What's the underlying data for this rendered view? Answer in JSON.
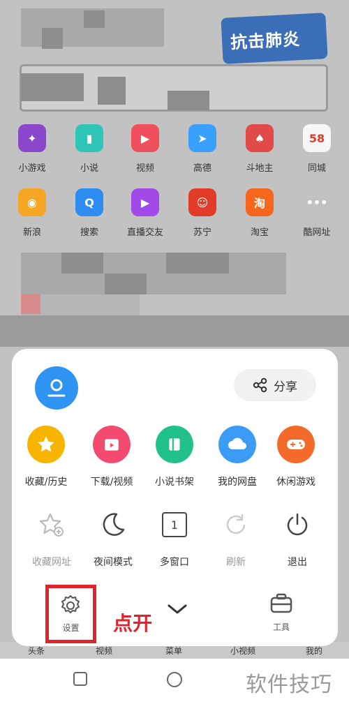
{
  "banner": {
    "text": "抗击肺炎"
  },
  "apps": [
    {
      "label": "小游戏",
      "color": "#8a47c9",
      "glyph": "✦"
    },
    {
      "label": "小说",
      "color": "#2ec4b6",
      "glyph": "▮"
    },
    {
      "label": "视频",
      "color": "#f0505e",
      "glyph": "▶"
    },
    {
      "label": "高德",
      "color": "#3aa0ff",
      "glyph": "➤"
    },
    {
      "label": "斗地主",
      "color": "#e24a4a",
      "glyph": "♠"
    },
    {
      "label": "同城",
      "color": "#f7f7f7",
      "glyph": "58"
    },
    {
      "label": "新浪",
      "color": "#f5a623",
      "glyph": "◉"
    },
    {
      "label": "搜索",
      "color": "#2d8cf0",
      "glyph": "Q"
    },
    {
      "label": "直播交友",
      "color": "#a149e8",
      "glyph": "▶"
    },
    {
      "label": "苏宁",
      "color": "#e23b2a",
      "glyph": "☺"
    },
    {
      "label": "淘宝",
      "color": "#f6661c",
      "glyph": "淘"
    },
    {
      "label": "酷网址",
      "color": "#c2c2c2",
      "glyph": "•••"
    }
  ],
  "bottom_tabs": [
    "头条",
    "视频",
    "菜单",
    "小视频",
    "我的"
  ],
  "menu": {
    "share_label": "分享",
    "row1": [
      {
        "label": "收藏/历史",
        "color": "#f7b500",
        "icon": "star-icon"
      },
      {
        "label": "下载/视频",
        "color": "#f34b6f",
        "icon": "download-folder-icon"
      },
      {
        "label": "小说书架",
        "color": "#21c18b",
        "icon": "book-icon"
      },
      {
        "label": "我的网盘",
        "color": "#3c9cf5",
        "icon": "cloud-icon"
      },
      {
        "label": "休闲游戏",
        "color": "#f36b2a",
        "icon": "gamepad-icon"
      }
    ],
    "row2": [
      {
        "label": "收藏网址",
        "disabled": true,
        "icon": "add-favorite-icon"
      },
      {
        "label": "夜间模式",
        "disabled": false,
        "icon": "moon-icon"
      },
      {
        "label": "多窗口",
        "disabled": false,
        "icon": "window-count-icon",
        "count": "1"
      },
      {
        "label": "刷新",
        "disabled": true,
        "icon": "refresh-icon"
      },
      {
        "label": "退出",
        "disabled": false,
        "icon": "power-icon"
      }
    ],
    "settings_label": "设置",
    "tools_label": "工具",
    "hint": "点开"
  },
  "watermark": "软件技巧"
}
